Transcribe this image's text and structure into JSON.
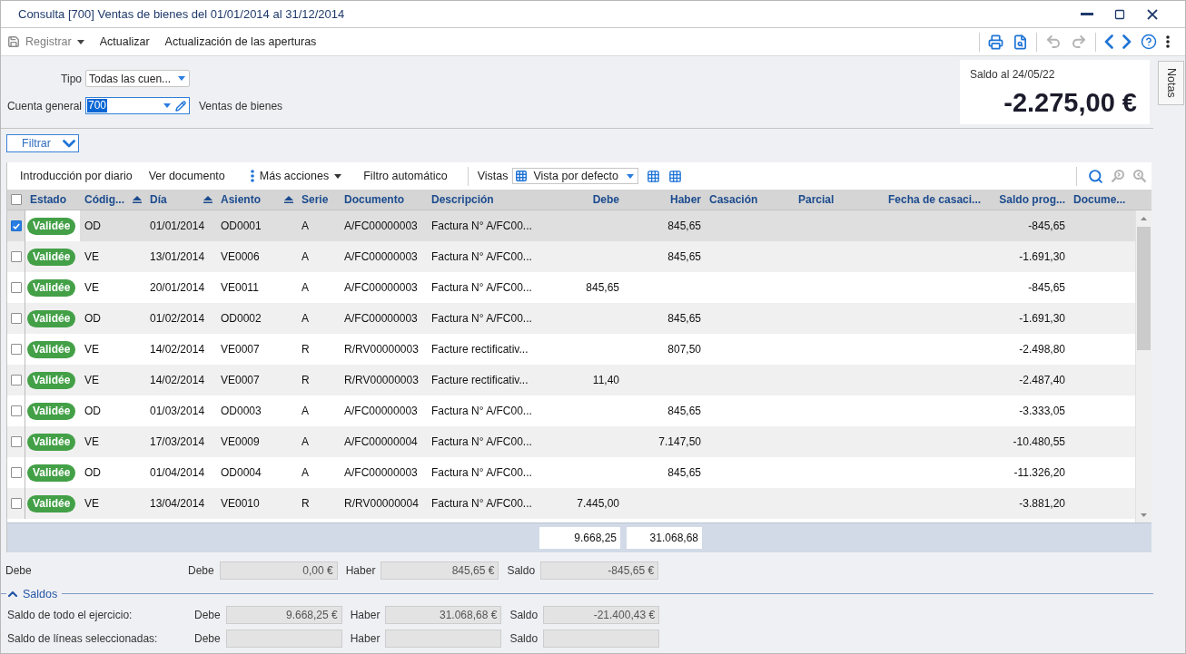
{
  "window": {
    "title": "Consulta [700] Ventas de bienes del 01/01/2014 al 31/12/2014"
  },
  "toolbar": {
    "actions": [
      {
        "label": "Registrar",
        "kind": "save",
        "disabled": true
      },
      {
        "label": "Actualizar",
        "kind": "plain",
        "disabled": false
      },
      {
        "label": "Actualización de las aperturas",
        "kind": "plain",
        "disabled": false
      }
    ],
    "tool_groups": [
      {
        "tools": [
          {
            "kind": "print",
            "disabled": false
          },
          {
            "kind": "preview",
            "disabled": false
          }
        ]
      },
      {
        "tools": [
          {
            "kind": "undo",
            "disabled": true
          },
          {
            "kind": "redo",
            "disabled": true
          }
        ]
      },
      {
        "tools": [
          {
            "kind": "back",
            "disabled": false
          },
          {
            "kind": "forward",
            "disabled": false
          },
          {
            "kind": "help",
            "disabled": false
          },
          {
            "kind": "more",
            "disabled": false
          }
        ]
      }
    ]
  },
  "form": {
    "tipo": {
      "label": "Tipo",
      "value": "Todas las cuen..."
    },
    "cuenta": {
      "label": "Cuenta general",
      "value": "700",
      "value_selected": true,
      "description": "Ventas de bienes"
    }
  },
  "balance": {
    "label": "Saldo al 24/05/22",
    "amount": "-2.275,00 €"
  },
  "notes_tab": {
    "label": "Notas"
  },
  "filter_button": {
    "label": "Filtrar"
  },
  "grid_toolbar": {
    "actions": [
      {
        "label": "Introducción por diario",
        "kind": "plain"
      },
      {
        "label": "Ver documento",
        "kind": "plain"
      },
      {
        "label": "Más acciones",
        "kind": "menu"
      },
      {
        "label": "Filtro automático",
        "kind": "plain"
      }
    ],
    "views_label": "Vistas",
    "view": "Vista por defecto",
    "search_tools": [
      {
        "kind": "search",
        "disabled": false
      },
      {
        "kind": "previous",
        "disabled": true
      },
      {
        "kind": "next",
        "disabled": true
      }
    ]
  },
  "table": {
    "all_checked": false,
    "columns": [
      {
        "label": "Estado",
        "kind": "status",
        "sorted": false
      },
      {
        "label": "Códig...",
        "kind": "text",
        "sorted": true
      },
      {
        "label": "Día",
        "kind": "text",
        "sorted": true
      },
      {
        "label": "Asiento",
        "kind": "text",
        "sorted": true
      },
      {
        "label": "Serie",
        "kind": "text",
        "sorted": false
      },
      {
        "label": "Documento",
        "kind": "text",
        "sorted": false
      },
      {
        "label": "Descripción",
        "kind": "text",
        "sorted": false
      },
      {
        "label": "Debe",
        "kind": "amount",
        "sorted": false
      },
      {
        "label": "Haber",
        "kind": "amount",
        "sorted": false
      },
      {
        "label": "Casación",
        "kind": "text",
        "sorted": false
      },
      {
        "label": "Parcial",
        "kind": "text",
        "sorted": false
      },
      {
        "label": "Fecha de casaci...",
        "kind": "text",
        "sorted": false
      },
      {
        "label": "Saldo prog...",
        "kind": "amount",
        "sorted": false
      },
      {
        "label": "Docume...",
        "kind": "text",
        "sorted": false
      }
    ],
    "rows": [
      {
        "checked": true,
        "selected": true,
        "status": "Validée",
        "codigo": "OD",
        "dia": "01/01/2014",
        "asiento": "OD0001",
        "serie": "A",
        "documento": "A/FC00000003",
        "descripcion": "Factura N° A/FC00...",
        "haber": "845,65",
        "saldo_prog": "-845,65"
      },
      {
        "checked": false,
        "selected": false,
        "status": "Validée",
        "codigo": "VE",
        "dia": "13/01/2014",
        "asiento": "VE0006",
        "serie": "A",
        "documento": "A/FC00000003",
        "descripcion": "Factura N° A/FC00...",
        "haber": "845,65",
        "saldo_prog": "-1.691,30"
      },
      {
        "checked": false,
        "selected": false,
        "status": "Validée",
        "codigo": "VE",
        "dia": "20/01/2014",
        "asiento": "VE0011",
        "serie": "A",
        "documento": "A/FC00000003",
        "descripcion": "Factura N° A/FC00...",
        "debe": "845,65",
        "saldo_prog": "-845,65"
      },
      {
        "checked": false,
        "selected": false,
        "status": "Validée",
        "codigo": "OD",
        "dia": "01/02/2014",
        "asiento": "OD0002",
        "serie": "A",
        "documento": "A/FC00000003",
        "descripcion": "Factura N° A/FC00...",
        "haber": "845,65",
        "saldo_prog": "-1.691,30"
      },
      {
        "checked": false,
        "selected": false,
        "status": "Validée",
        "codigo": "VE",
        "dia": "14/02/2014",
        "asiento": "VE0007",
        "serie": "R",
        "documento": "R/RV00000003",
        "descripcion": "Facture rectificativ...",
        "haber": "807,50",
        "saldo_prog": "-2.498,80"
      },
      {
        "checked": false,
        "selected": false,
        "status": "Validée",
        "codigo": "VE",
        "dia": "14/02/2014",
        "asiento": "VE0007",
        "serie": "R",
        "documento": "R/RV00000003",
        "descripcion": "Facture rectificativ...",
        "debe": "11,40",
        "saldo_prog": "-2.487,40"
      },
      {
        "checked": false,
        "selected": false,
        "status": "Validée",
        "codigo": "OD",
        "dia": "01/03/2014",
        "asiento": "OD0003",
        "serie": "A",
        "documento": "A/FC00000003",
        "descripcion": "Factura N° A/FC00...",
        "haber": "845,65",
        "saldo_prog": "-3.333,05"
      },
      {
        "checked": false,
        "selected": false,
        "status": "Validée",
        "codigo": "VE",
        "dia": "17/03/2014",
        "asiento": "VE0009",
        "serie": "A",
        "documento": "A/FC00000004",
        "descripcion": "Factura N° A/FC00...",
        "haber": "7.147,50",
        "saldo_prog": "-10.480,55"
      },
      {
        "checked": false,
        "selected": false,
        "status": "Validée",
        "codigo": "OD",
        "dia": "01/04/2014",
        "asiento": "OD0004",
        "serie": "A",
        "documento": "A/FC00000003",
        "descripcion": "Factura N° A/FC00...",
        "haber": "845,65",
        "saldo_prog": "-11.326,20"
      },
      {
        "checked": false,
        "selected": false,
        "status": "Validée",
        "codigo": "VE",
        "dia": "13/04/2014",
        "asiento": "VE0010",
        "serie": "R",
        "documento": "R/RV00000004",
        "descripcion": "Factura N° A/FC00...",
        "debe": "7.445,00",
        "saldo_prog": "-3.881,20"
      }
    ],
    "totals": {
      "debe": "9.668,25",
      "haber": "31.068,68"
    }
  },
  "selection_summary": {
    "label": "Debe",
    "fields": [
      {
        "label": "Debe",
        "value": "0,00 €",
        "disabled": true
      },
      {
        "label": "Haber",
        "value": "845,65 €",
        "disabled": true
      },
      {
        "label": "Saldo",
        "value": "-845,65 €",
        "disabled": true
      }
    ]
  },
  "saldos": {
    "title": "Saldos",
    "expanded": true,
    "rows": [
      {
        "label": "Saldo de todo el ejercicio:",
        "fields": [
          {
            "label": "Debe",
            "value": "9.668,25 €",
            "disabled": true
          },
          {
            "label": "Haber",
            "value": "31.068,68 €",
            "disabled": true
          },
          {
            "label": "Saldo",
            "value": "-21.400,43 €",
            "disabled": true
          }
        ]
      },
      {
        "label": "Saldo de líneas seleccionadas:",
        "fields": [
          {
            "label": "Debe",
            "disabled": true
          },
          {
            "label": "Haber",
            "disabled": true
          },
          {
            "label": "Saldo",
            "disabled": true
          }
        ]
      }
    ]
  }
}
